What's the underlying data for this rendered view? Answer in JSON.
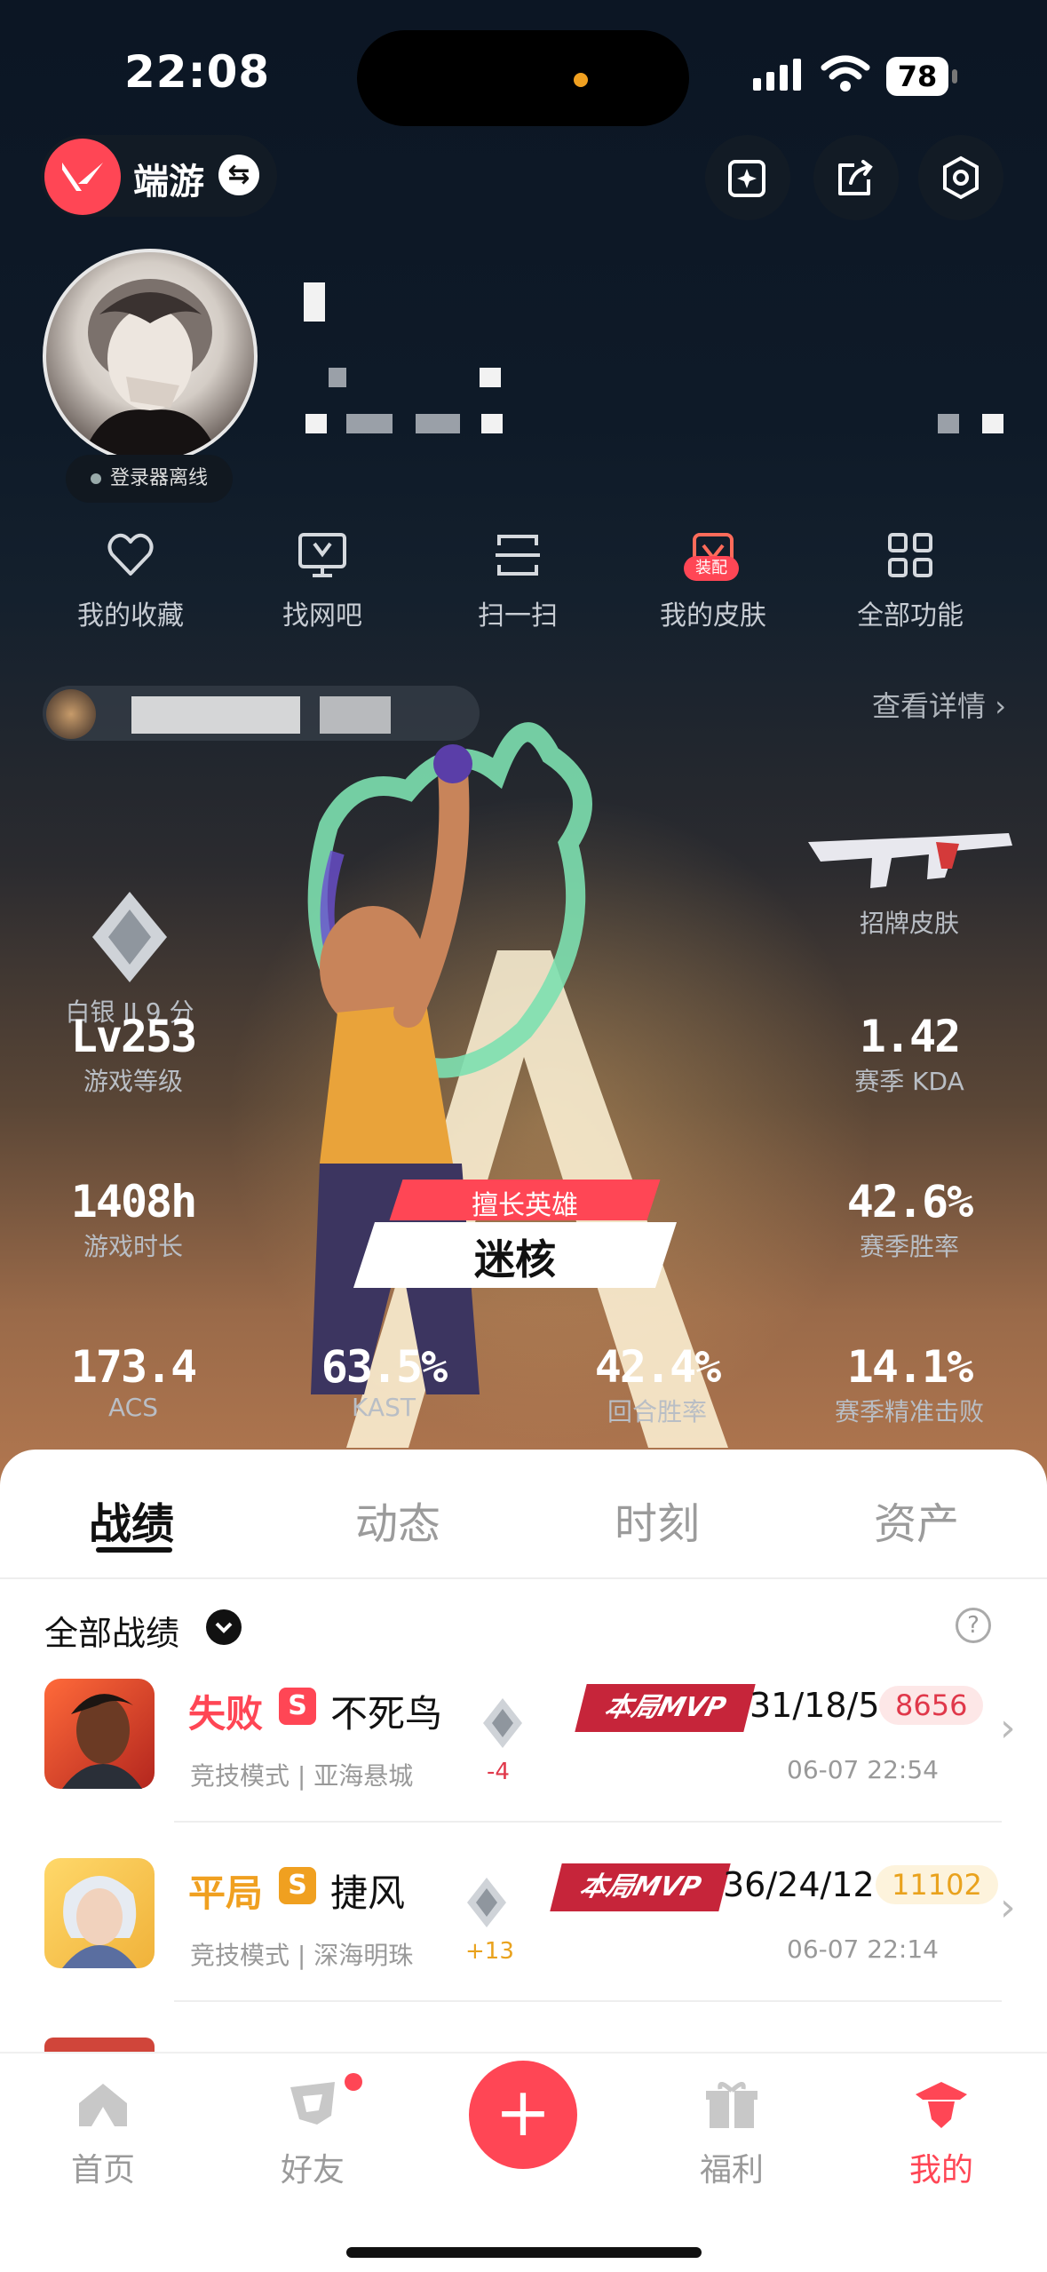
{
  "status_bar": {
    "time": "22:08",
    "battery": "78"
  },
  "header": {
    "mode_label": "端游",
    "swap_glyph": "⇆"
  },
  "profile": {
    "online_status": "登录器离线"
  },
  "quick_actions": [
    {
      "label": "我的收藏",
      "icon": "heart-icon"
    },
    {
      "label": "找网吧",
      "icon": "cafe-monitor-icon"
    },
    {
      "label": "扫一扫",
      "icon": "scan-icon"
    },
    {
      "label": "我的皮肤",
      "icon": "skin-icon",
      "badge": "装配"
    },
    {
      "label": "全部功能",
      "icon": "grid-icon"
    }
  ],
  "rank_row": {
    "detail_link": "查看详情",
    "detail_chevron": "›"
  },
  "stats": {
    "rank": "白银 II 9 分",
    "featured_skin": "招牌皮肤",
    "level_value": "Lv253",
    "level_label": "游戏等级",
    "kda_value": "1.42",
    "kda_label": "赛季 KDA",
    "playtime_value": "1408h",
    "playtime_label": "游戏时长",
    "winrate_value": "42.6%",
    "winrate_label": "赛季胜率",
    "acs_value": "173.4",
    "acs_label": "ACS",
    "kast_value": "63.5%",
    "kast_label": "KAST",
    "round_win_value": "42.4%",
    "round_win_label": "回合胜率",
    "precision_value": "14.1%",
    "precision_label": "赛季精准击败"
  },
  "hero": {
    "tag": "擅长英雄",
    "name": "迷核"
  },
  "tabs": [
    "战绩",
    "动态",
    "时刻",
    "资产"
  ],
  "filter": {
    "label": "全部战绩",
    "help": "?"
  },
  "matches": [
    {
      "result": "失败",
      "result_color": "#ff4655",
      "s_badge": "S",
      "agent": "不死鸟",
      "mode": "竞技模式 | 亚海悬城",
      "rank_change": "-4",
      "rank_color": "#e0384a",
      "mvp": "本局MVP",
      "kda": "31/18/5",
      "score": "8656",
      "score_bg": "#fde7e7",
      "score_color": "#e0384a",
      "date": "06-07 22:54",
      "chevron": "›"
    },
    {
      "result": "平局",
      "result_color": "#f0a020",
      "s_badge": "S",
      "agent": "捷风",
      "mode": "竞技模式 | 深海明珠",
      "rank_change": "+13",
      "rank_color": "#e9a21d",
      "mvp": "本局MVP",
      "kda": "36/24/12",
      "score": "11102",
      "score_bg": "#fdf3dc",
      "score_color": "#e9a21d",
      "date": "06-07 22:14",
      "chevron": "›"
    }
  ],
  "nav": [
    {
      "label": "首页",
      "icon": "home-icon"
    },
    {
      "label": "好友",
      "icon": "friends-icon"
    },
    {
      "label": "+",
      "icon": "plus-icon"
    },
    {
      "label": "福利",
      "icon": "gift-icon"
    },
    {
      "label": "我的",
      "icon": "profile-icon"
    }
  ],
  "colors": {
    "accent": "#ff4655",
    "dark": "#111111"
  }
}
